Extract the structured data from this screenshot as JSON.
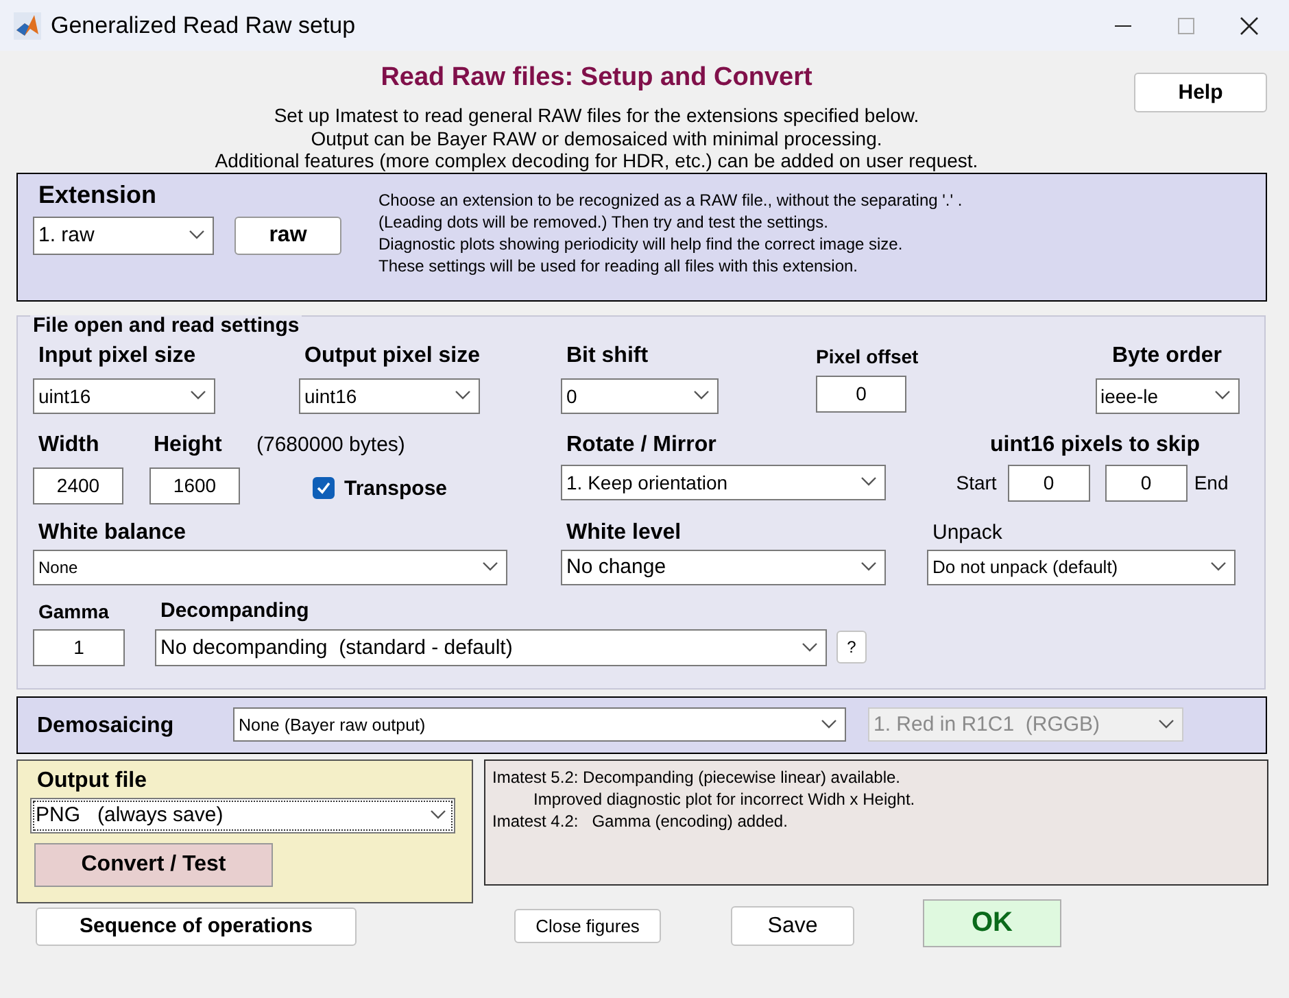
{
  "window": {
    "title": "Generalized Read Raw setup"
  },
  "header": {
    "title": "Read Raw files: Setup and Convert",
    "help_button": "Help",
    "description": [
      "Set up Imatest to read general RAW files for the extensions specified below.",
      "Output can be Bayer RAW or demosaiced with minimal processing.",
      "Additional features (more complex decoding for HDR, etc.) can be added on user request."
    ]
  },
  "extension": {
    "label": "Extension",
    "selector": "1. raw",
    "value_button": "raw",
    "notes": [
      "Choose an extension to be recognized as a RAW file., without the separating '.' .",
      "(Leading dots will be removed.) Then try and test the settings.",
      "Diagnostic plots showing periodicity will help find the correct image size.",
      "These settings will be used for reading all files with this extension."
    ]
  },
  "file_settings": {
    "title": "File open and read settings",
    "input_pixel_size": {
      "label": "Input pixel size",
      "value": "uint16"
    },
    "output_pixel_size": {
      "label": "Output pixel size",
      "value": "uint16"
    },
    "bit_shift": {
      "label": "Bit shift",
      "value": "0"
    },
    "pixel_offset": {
      "label": "Pixel offset",
      "value": "0"
    },
    "byte_order": {
      "label": "Byte order",
      "value": "ieee-le"
    },
    "width": {
      "label": "Width",
      "value": "2400"
    },
    "height": {
      "label": "Height",
      "value": "1600"
    },
    "size_note": "(7680000 bytes)",
    "transpose": {
      "label": "Transpose",
      "checked": true
    },
    "rotate_mirror": {
      "label": "Rotate / Mirror",
      "value": "1. Keep orientation"
    },
    "skip": {
      "label": "uint16 pixels to skip",
      "start_label": "Start",
      "start": "0",
      "end": "0",
      "end_label": "End"
    },
    "white_balance": {
      "label": "White balance",
      "value": "None"
    },
    "white_level": {
      "label": "White level",
      "value": "No change"
    },
    "unpack": {
      "label": "Unpack",
      "value": "Do not unpack (default)"
    },
    "gamma": {
      "label": "Gamma",
      "value": "1"
    },
    "decompanding": {
      "label": "Decompanding",
      "value": "No decompanding  (standard - default)",
      "help_button": "?"
    }
  },
  "demosaicing": {
    "label": "Demosaicing",
    "method": {
      "value": "None (Bayer raw output)",
      "disabled": false
    },
    "pattern": {
      "value": "1. Red in R1C1  (RGGB)",
      "disabled": true
    }
  },
  "output_file": {
    "label": "Output file",
    "format": "PNG   (always save)",
    "convert_button": "Convert / Test"
  },
  "log": [
    "Imatest 5.2: Decompanding (piecewise linear) available.",
    "         Improved diagnostic plot for incorrect Widh x Height.",
    "Imatest 4.2:   Gamma (encoding) added."
  ],
  "buttons": {
    "sequence": "Sequence of operations",
    "close_figures": "Close figures",
    "save": "Save",
    "ok": "OK"
  }
}
